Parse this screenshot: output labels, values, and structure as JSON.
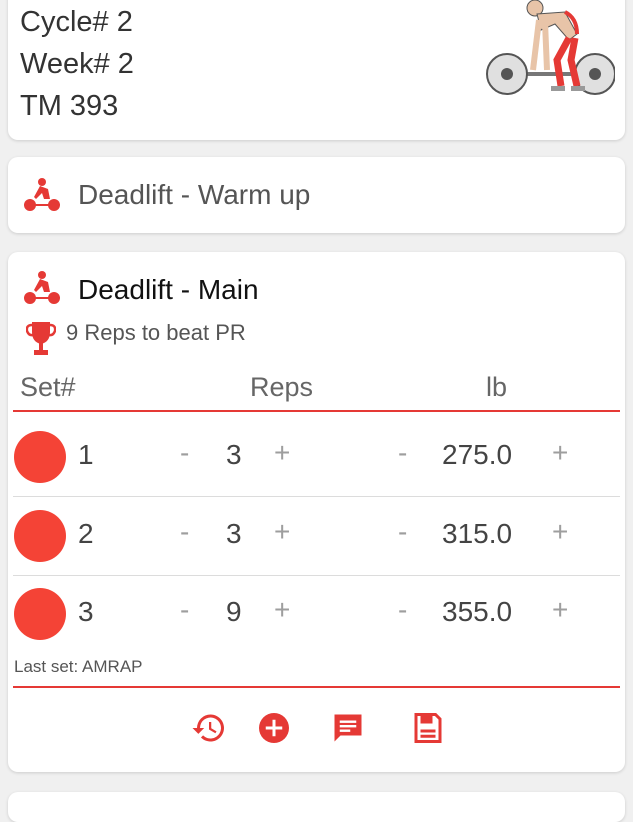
{
  "info": {
    "cycle": "Cycle# 2",
    "week": "Week# 2",
    "tm": "TM 393"
  },
  "warmup": {
    "title": "Deadlift - Warm up",
    "icon": "deadlift-icon"
  },
  "main": {
    "title": "Deadlift - Main",
    "icon": "deadlift-icon",
    "pr_text": "9 Reps to beat PR",
    "pr_icon": "trophy-icon",
    "headers": {
      "set": "Set#",
      "reps": "Reps",
      "weight": "lb"
    },
    "sets": [
      {
        "set": "1",
        "reps": "3",
        "weight": "275.0"
      },
      {
        "set": "2",
        "reps": "3",
        "weight": "315.0"
      },
      {
        "set": "3",
        "reps": "9",
        "weight": "355.0"
      }
    ],
    "minus": "-",
    "plus": "+",
    "last_set_note": "Last set: AMRAP",
    "actions": [
      "history-icon",
      "add-circle-icon",
      "comment-icon",
      "save-icon"
    ]
  },
  "colors": {
    "accent": "#f44336",
    "divider": "#e53935",
    "background": "#f0f0f0"
  }
}
